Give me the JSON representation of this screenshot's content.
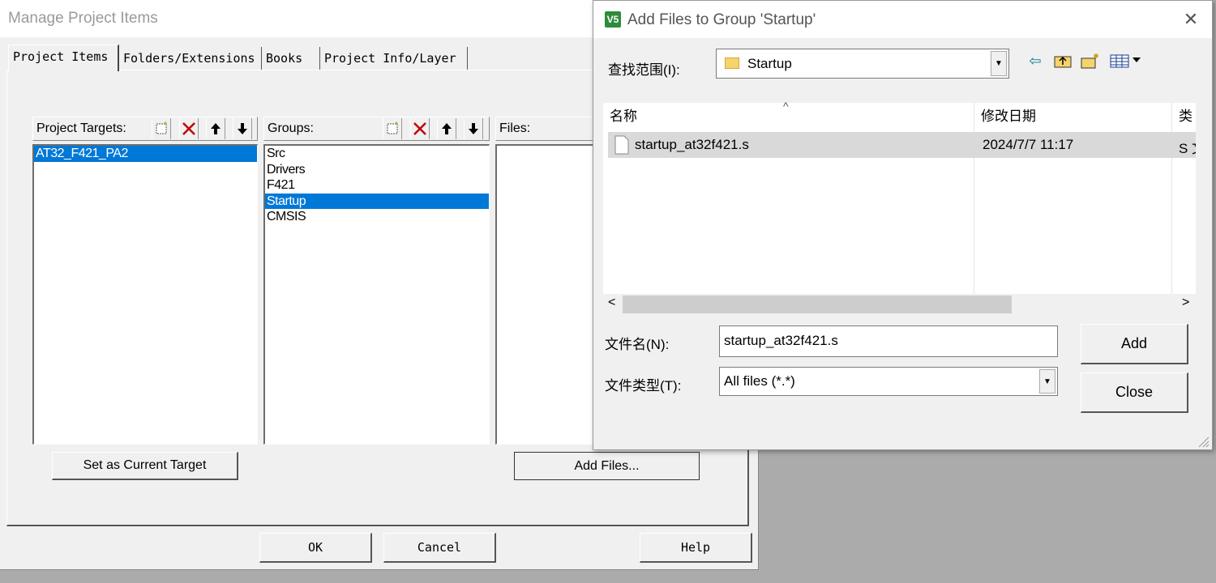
{
  "manage_dialog": {
    "title": "Manage Project Items",
    "tabs": [
      "Project Items",
      "Folders/Extensions",
      "Books",
      "Project Info/Layer"
    ],
    "targets": {
      "label": "Project Targets:",
      "items": [
        "AT32_F421_PA2"
      ],
      "selected_index": 0
    },
    "groups": {
      "label": "Groups:",
      "items": [
        "Src",
        "Drivers",
        "F421",
        "Startup",
        "CMSIS"
      ],
      "selected_index": 3
    },
    "files": {
      "label": "Files:"
    },
    "set_target_button": "Set as Current Target",
    "add_files_button": "Add Files...",
    "ok_button": "OK",
    "cancel_button": "Cancel",
    "help_button": "Help"
  },
  "add_files_dialog": {
    "title": "Add Files to Group 'Startup'",
    "app_icon_text": "V5",
    "look_in_label": "查找范围(I):",
    "look_in_value": "Startup",
    "columns": [
      "名称",
      "修改日期",
      "类"
    ],
    "files": [
      {
        "name": "startup_at32f421.s",
        "date": "2024/7/7 11:17",
        "type": "S ⁠文"
      }
    ],
    "filename_label": "文件名(N):",
    "filename_value": "startup_at32f421.s",
    "filetype_label": "文件类型(T):",
    "filetype_value": "All files (*.*)",
    "add_button": "Add",
    "close_button": "Close",
    "icons": [
      "back-icon",
      "up-folder-icon",
      "new-folder-icon",
      "view-menu-icon"
    ]
  },
  "colors": {
    "selection": "#0078d7",
    "dialog_bg": "#f0f0f0",
    "desktop_bg": "#ababab"
  }
}
